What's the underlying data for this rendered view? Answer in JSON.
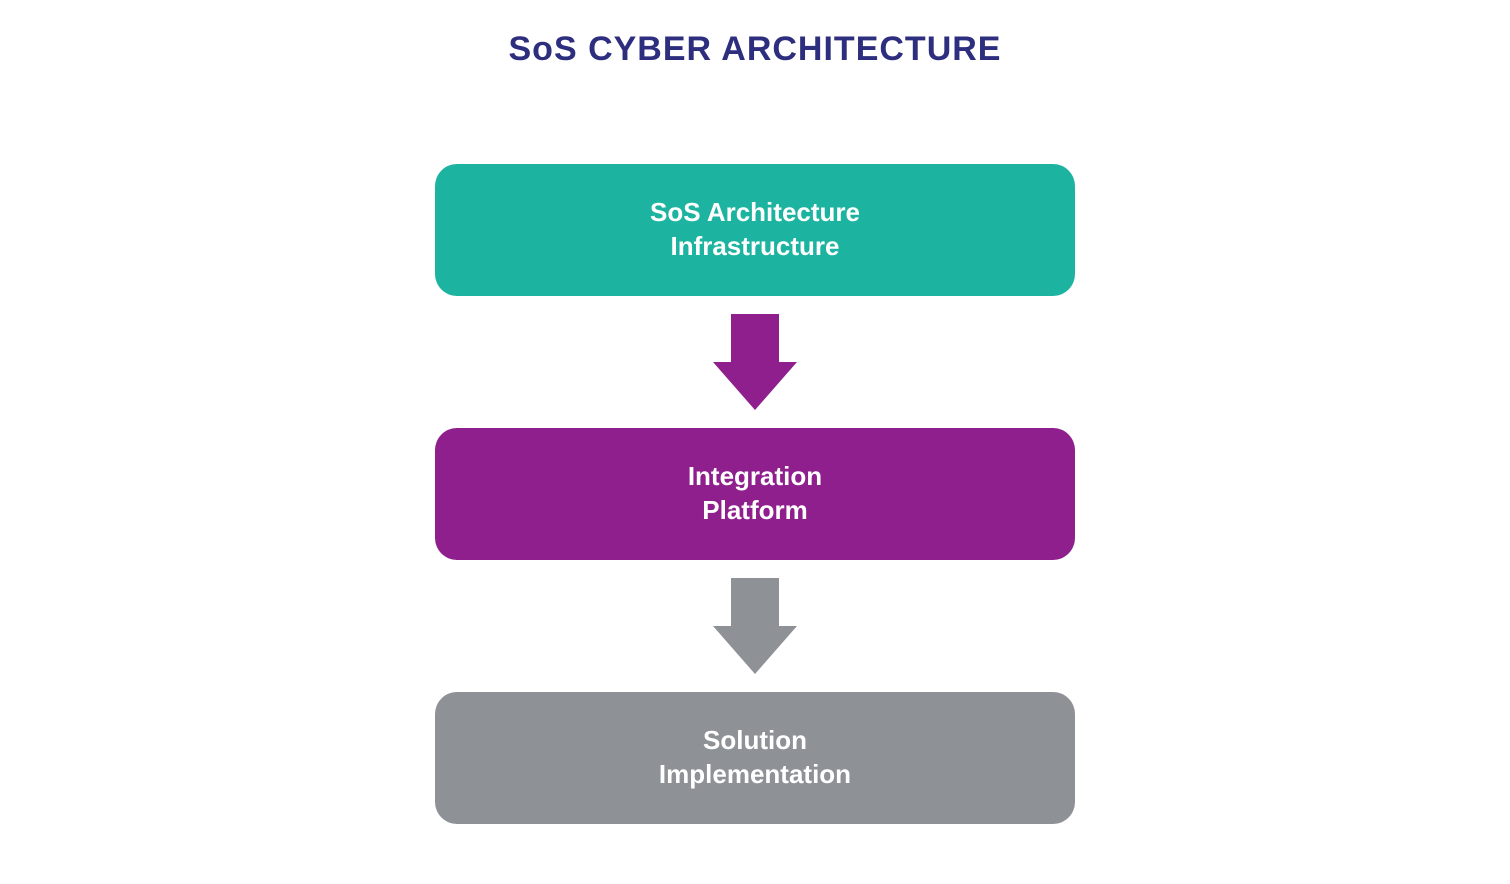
{
  "title": "SoS CYBER ARCHITECTURE",
  "boxes": {
    "top": {
      "line1": "SoS Architecture",
      "line2": "Infrastructure",
      "color": "#1cb4a0"
    },
    "middle": {
      "line1": "Integration",
      "line2": "Platform",
      "color": "#8e1f8c"
    },
    "bottom": {
      "line1": "Solution",
      "line2": "Implementation",
      "color": "#8e9196"
    }
  },
  "arrows": {
    "first": {
      "color": "#8e1f8c"
    },
    "second": {
      "color": "#8e9196"
    }
  }
}
